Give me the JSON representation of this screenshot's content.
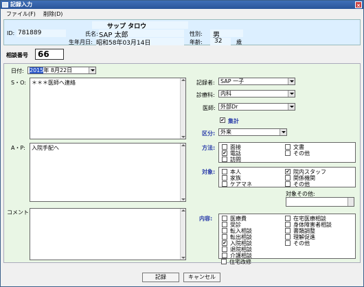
{
  "window": {
    "title": "記録入力",
    "close_glyph": "×"
  },
  "menu": {
    "file": "ファイル(F)",
    "delete": "削除(D)"
  },
  "header": {
    "kana_name": "サップ タロウ",
    "id_label": "ID:",
    "id_value": "781889",
    "name_label": "氏名:",
    "name_value": "SAP 太郎",
    "gender_label": "性別:",
    "gender_value": "男",
    "dob_label": "生年月日:",
    "dob_value": "昭和58年03月14日",
    "age_label": "年齢:",
    "age_value": "32",
    "age_unit": "歳"
  },
  "consult": {
    "label": "相談番号",
    "value": "66"
  },
  "form": {
    "date_label": "日付:",
    "date_year_selected": "2015",
    "date_rest": "年  8月22日",
    "so_label": "S・O:",
    "so_text": "＊＊＊医師へ連絡",
    "ap_label": "A・P:",
    "ap_text": "入院手配へ",
    "comment_label": "コメント:",
    "comment_text": "",
    "recorder_label": "記録者:",
    "recorder_value": "SAP 一子",
    "dept_label": "診療科:",
    "dept_value": "内科",
    "doctor_label": "医師:",
    "doctor_value": "外部Dr",
    "tally_label": "集計",
    "category_label": "区分:",
    "category_value": "外来",
    "method_label": "方法:",
    "method_options": [
      {
        "label": "面接",
        "checked": false
      },
      {
        "label": "文書",
        "checked": false
      },
      {
        "label": "電話",
        "checked": true
      },
      {
        "label": "その他",
        "checked": false
      },
      {
        "label": "訪問",
        "checked": false
      }
    ],
    "target_label": "対象:",
    "target_options": [
      {
        "label": "本人",
        "checked": false
      },
      {
        "label": "院内スタッフ",
        "checked": true
      },
      {
        "label": "家族",
        "checked": false
      },
      {
        "label": "関係機関",
        "checked": false
      },
      {
        "label": "ケアマネ",
        "checked": false
      },
      {
        "label": "その他",
        "checked": false
      }
    ],
    "target_other_label": "対象その他:",
    "content_label": "内容:",
    "content_options": [
      {
        "label": "医療費",
        "checked": false
      },
      {
        "label": "在宅医療相談",
        "checked": false
      },
      {
        "label": "受診",
        "checked": false
      },
      {
        "label": "身体障害者相談",
        "checked": false
      },
      {
        "label": "転入相談",
        "checked": false
      },
      {
        "label": "書類調整",
        "checked": false
      },
      {
        "label": "転出相談",
        "checked": false
      },
      {
        "label": "理解促進",
        "checked": false
      },
      {
        "label": "入院相談",
        "checked": true
      },
      {
        "label": "その他",
        "checked": false
      },
      {
        "label": "退院相談",
        "checked": false
      },
      {
        "label": "介護相談",
        "checked": false
      },
      {
        "label": "住宅改修",
        "checked": false
      }
    ]
  },
  "buttons": {
    "save": "記録",
    "cancel": "キャンセル"
  },
  "icons": {
    "check_glyph": "✔"
  },
  "colors": {
    "header_bg": "#dcefff",
    "panel_bg": "#e9f6e5",
    "title_bg": "#2a5599",
    "label_blue": "#2a3caa"
  }
}
